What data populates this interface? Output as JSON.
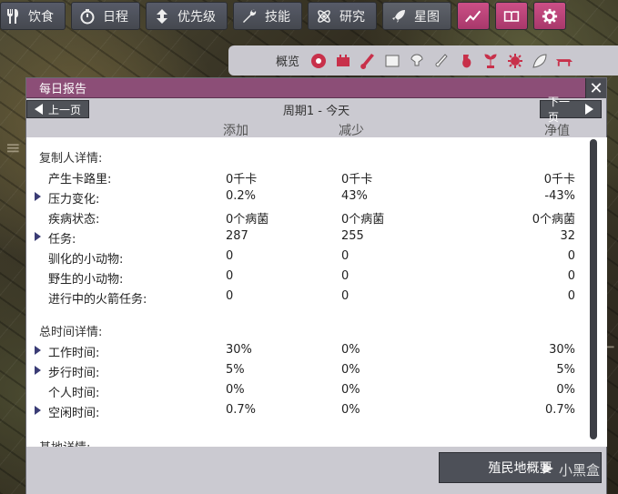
{
  "toolbar": {
    "diet": "饮食",
    "schedule": "日程",
    "priorities": "优先级",
    "skills": "技能",
    "research": "研究",
    "starmap": "星图"
  },
  "overview": {
    "label": "概览"
  },
  "panel": {
    "title": "每日报告",
    "prev": "上一页",
    "next": "下一页",
    "period": "周期1 - 今天",
    "col_add": "添加",
    "col_remove": "减少",
    "col_net": "净值"
  },
  "sections": [
    {
      "title": "复制人详情:",
      "rows": [
        {
          "label": "产生卡路里:",
          "add": "0千卡",
          "remove": "0千卡",
          "net": "0千卡",
          "expandable": false
        },
        {
          "label": "压力变化:",
          "add": "0.2%",
          "remove": "43%",
          "net": "-43%",
          "expandable": true
        },
        {
          "label": "疾病状态:",
          "add": "0个病菌",
          "remove": "0个病菌",
          "net": "0个病菌",
          "expandable": false
        },
        {
          "label": "任务:",
          "add": "287",
          "remove": "255",
          "net": "32",
          "expandable": true
        },
        {
          "label": "驯化的小动物:",
          "add": "0",
          "remove": "0",
          "net": "0",
          "expandable": false
        },
        {
          "label": "野生的小动物:",
          "add": "0",
          "remove": "0",
          "net": "0",
          "expandable": false
        },
        {
          "label": "进行中的火箭任务:",
          "add": "0",
          "remove": "0",
          "net": "0",
          "expandable": false
        }
      ]
    },
    {
      "title": "总时间详情:",
      "rows": [
        {
          "label": "工作时间:",
          "add": "30%",
          "remove": "0%",
          "net": "30%",
          "expandable": true
        },
        {
          "label": "步行时间:",
          "add": "5%",
          "remove": "0%",
          "net": "5%",
          "expandable": true
        },
        {
          "label": "个人时间:",
          "add": "0%",
          "remove": "0%",
          "net": "0%",
          "expandable": false
        },
        {
          "label": "空闲时间:",
          "add": "0.7%",
          "remove": "0%",
          "net": "0.7%",
          "expandable": true
        }
      ]
    },
    {
      "title": "基地详情:",
      "rows": []
    }
  ],
  "footer": {
    "colony_button": "殖民地概要"
  },
  "watermark": "小黑盒",
  "colors": {
    "header": "#8c4e77",
    "pink_button": "#cc4f86",
    "expand_arrow": "#3a3c75"
  }
}
